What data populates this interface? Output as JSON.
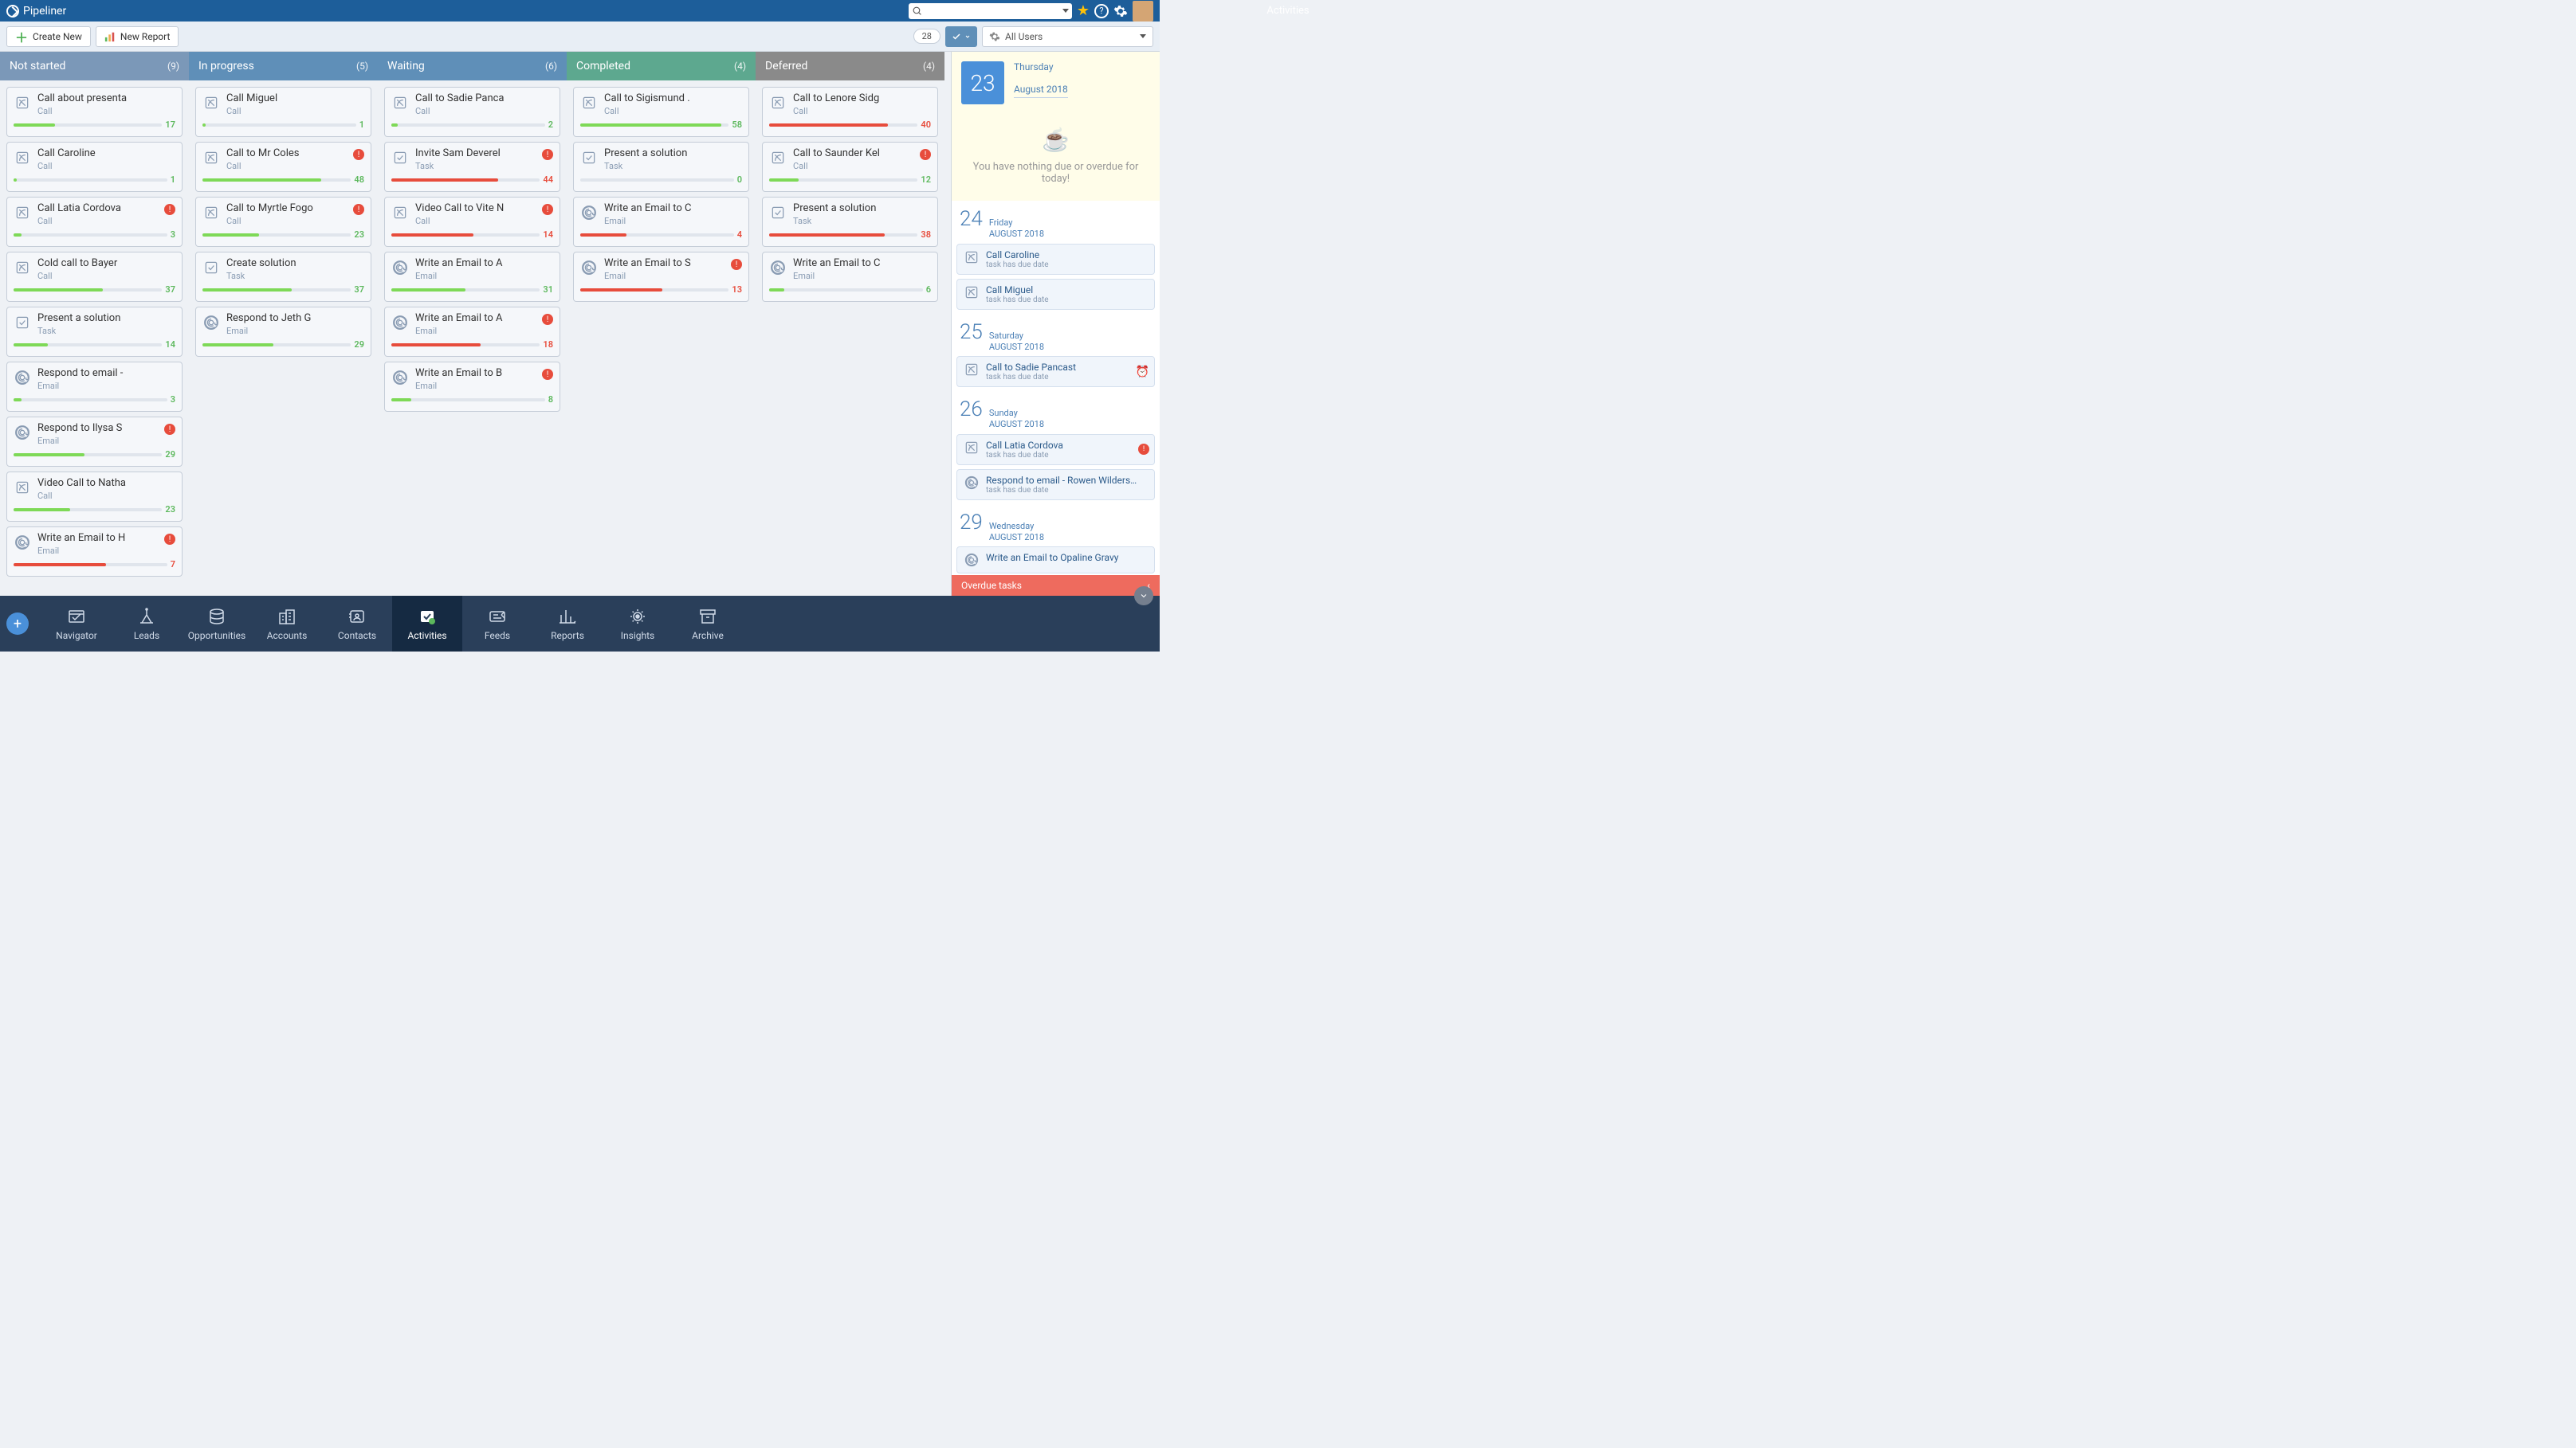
{
  "app": {
    "name": "Pipeliner",
    "title": "Activities"
  },
  "toolbar": {
    "create": "Create New",
    "report": "New Report",
    "count": "28",
    "users": "All Users"
  },
  "columns": [
    {
      "id": "notstarted",
      "label": "Not started",
      "count": "(9)",
      "hclass": "h-notstarted",
      "cards": [
        {
          "title": "Call about presenta",
          "type": "Call",
          "icon": "call",
          "num": "17",
          "color": "green",
          "fill": 28
        },
        {
          "title": "Call Caroline",
          "type": "Call",
          "icon": "call",
          "num": "1",
          "color": "green",
          "fill": 2
        },
        {
          "title": "Call Latia Cordova",
          "type": "Call",
          "icon": "call",
          "num": "3",
          "color": "green",
          "fill": 5,
          "alert": true
        },
        {
          "title": "Cold call to Bayer",
          "type": "Call",
          "icon": "call",
          "num": "37",
          "color": "green",
          "fill": 60
        },
        {
          "title": "Present a solution",
          "type": "Task",
          "icon": "task",
          "num": "14",
          "color": "green",
          "fill": 23
        },
        {
          "title": "Respond to email -",
          "type": "Email",
          "icon": "email",
          "num": "3",
          "color": "green",
          "fill": 5
        },
        {
          "title": "Respond to Ilysa S",
          "type": "Email",
          "icon": "email",
          "num": "29",
          "color": "green",
          "fill": 48,
          "alert": true
        },
        {
          "title": "Video Call to Natha",
          "type": "Call",
          "icon": "call",
          "num": "23",
          "color": "green",
          "fill": 38
        },
        {
          "title": "Write an Email to H",
          "type": "Email",
          "icon": "email",
          "num": "7",
          "color": "red",
          "fill": 60,
          "alert": true
        }
      ]
    },
    {
      "id": "inprogress",
      "label": "In progress",
      "count": "(5)",
      "hclass": "h-inprogress",
      "cards": [
        {
          "title": "Call Miguel",
          "type": "Call",
          "icon": "call",
          "num": "1",
          "color": "green",
          "fill": 2
        },
        {
          "title": "Call to Mr Coles",
          "type": "Call",
          "icon": "call",
          "num": "48",
          "color": "green",
          "fill": 80,
          "alert": true
        },
        {
          "title": "Call to Myrtle Fogo",
          "type": "Call",
          "icon": "call",
          "num": "23",
          "color": "green",
          "fill": 38,
          "alert": true
        },
        {
          "title": "Create solution",
          "type": "Task",
          "icon": "task",
          "num": "37",
          "color": "green",
          "fill": 60
        },
        {
          "title": "Respond to Jeth G",
          "type": "Email",
          "icon": "email",
          "num": "29",
          "color": "green",
          "fill": 48
        }
      ]
    },
    {
      "id": "waiting",
      "label": "Waiting",
      "count": "(6)",
      "hclass": "h-waiting",
      "cards": [
        {
          "title": "Call to Sadie Panca",
          "type": "Call",
          "icon": "call",
          "num": "2",
          "color": "green",
          "fill": 4
        },
        {
          "title": "Invite Sam Deverel",
          "type": "Task",
          "icon": "task",
          "num": "44",
          "color": "red",
          "fill": 72,
          "alert": true
        },
        {
          "title": "Video Call to Vite N",
          "type": "Call",
          "icon": "call",
          "num": "14",
          "color": "red",
          "fill": 55,
          "alert": true
        },
        {
          "title": "Write an Email to A",
          "type": "Email",
          "icon": "email",
          "num": "31",
          "color": "green",
          "fill": 50
        },
        {
          "title": "Write an Email to A",
          "type": "Email",
          "icon": "email",
          "num": "18",
          "color": "red",
          "fill": 60,
          "alert": true
        },
        {
          "title": "Write an Email to B",
          "type": "Email",
          "icon": "email",
          "num": "8",
          "color": "green",
          "fill": 13,
          "alert": true
        }
      ]
    },
    {
      "id": "completed",
      "label": "Completed",
      "count": "(4)",
      "hclass": "h-completed",
      "cards": [
        {
          "title": "Call to Sigismund .",
          "type": "Call",
          "icon": "call",
          "num": "58",
          "color": "green",
          "fill": 95
        },
        {
          "title": "Present a solution",
          "type": "Task",
          "icon": "task",
          "num": "0",
          "color": "green",
          "fill": 0
        },
        {
          "title": "Write an Email to C",
          "type": "Email",
          "icon": "email",
          "num": "4",
          "color": "red",
          "fill": 30
        },
        {
          "title": "Write an Email to S",
          "type": "Email",
          "icon": "email",
          "num": "13",
          "color": "red",
          "fill": 55,
          "alert": true
        }
      ]
    },
    {
      "id": "deferred",
      "label": "Deferred",
      "count": "(4)",
      "hclass": "h-deferred",
      "cards": [
        {
          "title": "Call to Lenore Sidg",
          "type": "Call",
          "icon": "call",
          "num": "40",
          "color": "red",
          "fill": 80
        },
        {
          "title": "Call to Saunder Kel",
          "type": "Call",
          "icon": "call",
          "num": "12",
          "color": "green",
          "fill": 20,
          "alert": true
        },
        {
          "title": "Present a solution",
          "type": "Task",
          "icon": "task",
          "num": "38",
          "color": "red",
          "fill": 78
        },
        {
          "title": "Write an Email to C",
          "type": "Email",
          "icon": "email",
          "num": "6",
          "color": "green",
          "fill": 10
        }
      ]
    }
  ],
  "sidebar": {
    "today": {
      "num": "23",
      "day": "Thursday",
      "month": "August 2018"
    },
    "nothing": "You have nothing due or overdue for today!",
    "dates": [
      {
        "num": "24",
        "day": "Friday",
        "month": "AUGUST 2018",
        "items": [
          {
            "title": "Call Caroline",
            "sub": "task has due date",
            "icon": "call"
          },
          {
            "title": "Call Miguel",
            "sub": "task has due date",
            "icon": "call"
          }
        ]
      },
      {
        "num": "25",
        "day": "Saturday",
        "month": "AUGUST 2018",
        "items": [
          {
            "title": "Call to Sadie Pancast",
            "sub": "task has due date",
            "icon": "call",
            "clock": true
          }
        ]
      },
      {
        "num": "26",
        "day": "Sunday",
        "month": "AUGUST 2018",
        "items": [
          {
            "title": "Call Latia Cordova",
            "sub": "task has due date",
            "icon": "call",
            "alert": true
          },
          {
            "title": "Respond to email - Rowen Wilders…",
            "sub": "task has due date",
            "icon": "email"
          }
        ]
      },
      {
        "num": "29",
        "day": "Wednesday",
        "month": "AUGUST 2018",
        "items": [
          {
            "title": "Write an Email to Opaline Gravy",
            "sub": "",
            "icon": "email"
          }
        ]
      }
    ],
    "overdue": "Overdue tasks"
  },
  "nav": {
    "items": [
      {
        "id": "navigator",
        "label": "Navigator"
      },
      {
        "id": "leads",
        "label": "Leads"
      },
      {
        "id": "opportunities",
        "label": "Opportunities"
      },
      {
        "id": "accounts",
        "label": "Accounts"
      },
      {
        "id": "contacts",
        "label": "Contacts"
      },
      {
        "id": "activities",
        "label": "Activities",
        "active": true
      },
      {
        "id": "feeds",
        "label": "Feeds"
      },
      {
        "id": "reports",
        "label": "Reports"
      },
      {
        "id": "insights",
        "label": "Insights"
      },
      {
        "id": "archive",
        "label": "Archive"
      }
    ]
  }
}
